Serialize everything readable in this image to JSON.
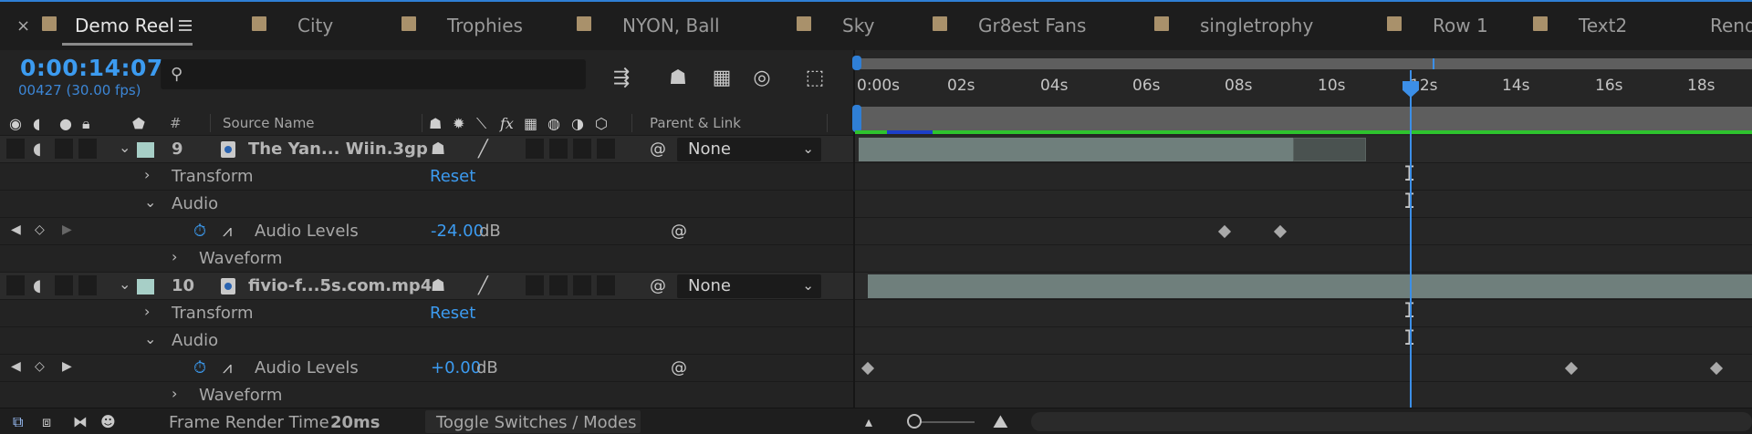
{
  "tabs": {
    "close_glyph": "×",
    "active": "Demo Reel",
    "items": [
      "City",
      "Trophies",
      "NYON, Ball",
      "Sky",
      "Gr8est Fans",
      "singletrophy",
      "Row 1",
      "Text2",
      "Rende"
    ]
  },
  "header": {
    "timecode": "0:00:14:07",
    "frames": "00427 (30.00 fps)",
    "search_placeholder": ""
  },
  "columns": {
    "hash": "#",
    "source_name": "Source Name",
    "parent_link": "Parent & Link",
    "fx": "fx"
  },
  "layers": [
    {
      "number": "9",
      "name": "The Yan... Wiin.3gp",
      "parent": "None",
      "transform": {
        "label": "Transform",
        "value": "Reset"
      },
      "audio": {
        "label": "Audio"
      },
      "audio_levels": {
        "label": "Audio Levels",
        "value": "-24.00",
        "unit": "dB"
      },
      "waveform": {
        "label": "Waveform"
      }
    },
    {
      "number": "10",
      "name": "fivio-f...5s.com.mp4",
      "parent": "None",
      "transform": {
        "label": "Transform",
        "value": "Reset"
      },
      "audio": {
        "label": "Audio"
      },
      "audio_levels": {
        "label": "Audio Levels",
        "value": "+0.00",
        "unit": "dB"
      },
      "waveform": {
        "label": "Waveform"
      }
    }
  ],
  "ruler": {
    "ticks": [
      "0:00s",
      "02s",
      "04s",
      "06s",
      "08s",
      "10s",
      "12s",
      "14s",
      "16s",
      "18s"
    ]
  },
  "bottom": {
    "frame_render_label": "Frame Render Time",
    "frame_render_value": "20ms",
    "toggle_label": "Toggle Switches / Modes"
  },
  "colors": {
    "accent": "#3c9bf0",
    "label_color": "#a7cfc7",
    "render_ok": "#38d46a",
    "cache_green": "#2ec32e",
    "cache_blue": "#1c3fc8"
  }
}
